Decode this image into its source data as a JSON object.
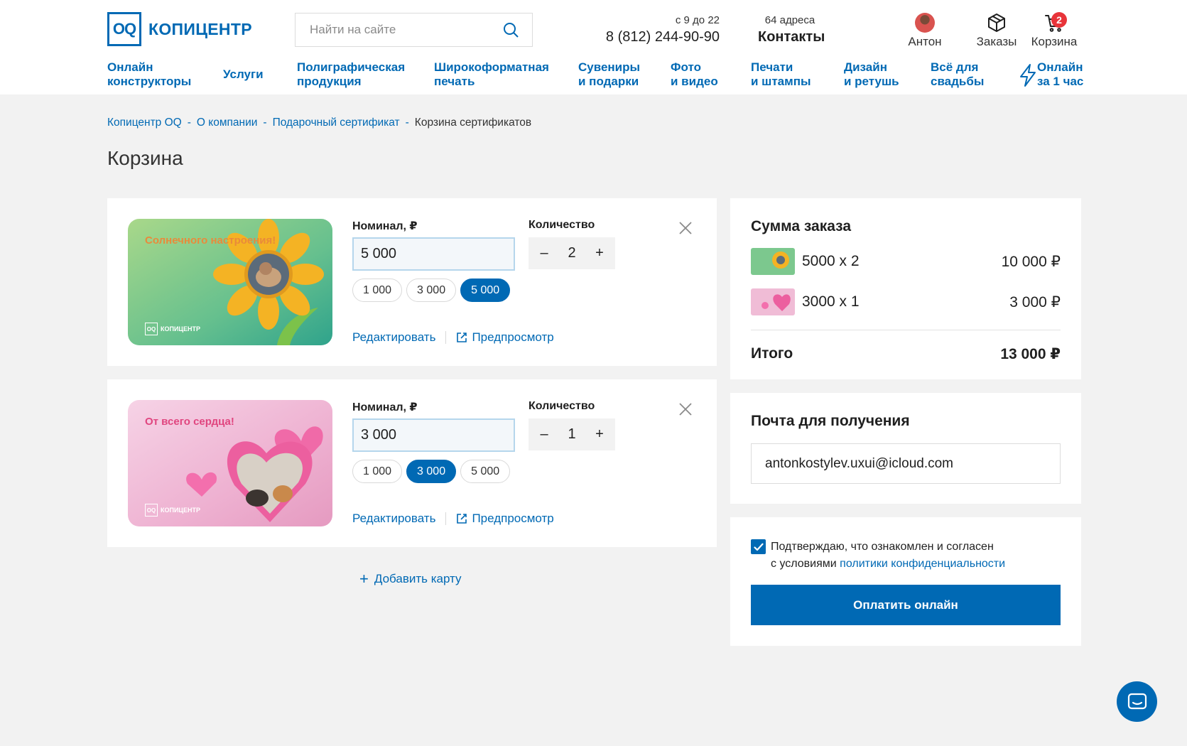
{
  "header": {
    "logo_mark": "OQ",
    "logo_text": "КОПИЦЕНТР",
    "search_placeholder": "Найти на сайте",
    "hours": "с 9 до 22",
    "phone": "8 (812) 244-90-90",
    "addresses": "64 адреса",
    "contacts": "Контакты",
    "user_name": "Антон",
    "orders": "Заказы",
    "cart": "Корзина",
    "cart_count": "2"
  },
  "nav": [
    {
      "l1": "Онлайн",
      "l2": "конструкторы"
    },
    {
      "l1": "Услуги",
      "l2": ""
    },
    {
      "l1": "Полиграфическая",
      "l2": "продукция"
    },
    {
      "l1": "Широкоформатная",
      "l2": "печать"
    },
    {
      "l1": "Сувениры",
      "l2": "и подарки"
    },
    {
      "l1": "Фото",
      "l2": "и видео"
    },
    {
      "l1": "Печати",
      "l2": "и штампы"
    },
    {
      "l1": "Дизайн",
      "l2": "и ретушь"
    },
    {
      "l1": "Всё для",
      "l2": "свадьбы"
    },
    {
      "l1": "Онлайн",
      "l2": "за 1 час"
    }
  ],
  "breadcrumb": {
    "items": [
      "Копицентр OQ",
      "О компании",
      "Подарочный сертификат"
    ],
    "current": "Корзина сертификатов",
    "separator": "-"
  },
  "page_title": "Корзина",
  "cart_items": [
    {
      "card_text": "Солнечного настроения!",
      "card_brand": "КОПИЦЕНТР",
      "nominal_label": "Номинал, ₽",
      "nominal_value": "5 000",
      "chips": [
        "1 000",
        "3 000",
        "5 000"
      ],
      "active_chip": 2,
      "quantity_label": "Количество",
      "quantity": "2",
      "minus": "–",
      "plus": "+",
      "edit": "Редактировать",
      "preview": "Предпросмотр"
    },
    {
      "card_text": "От всего сердца!",
      "card_brand": "КОПИЦЕНТР",
      "nominal_label": "Номинал, ₽",
      "nominal_value": "3 000",
      "chips": [
        "1 000",
        "3 000",
        "5 000"
      ],
      "active_chip": 1,
      "quantity_label": "Количество",
      "quantity": "1",
      "minus": "–",
      "plus": "+",
      "edit": "Редактировать",
      "preview": "Предпросмотр"
    }
  ],
  "add_card": "Добавить карту",
  "summary": {
    "title": "Сумма заказа",
    "rows": [
      {
        "name": "5000 x 2",
        "price": "10 000 ₽"
      },
      {
        "name": "3000 x 1",
        "price": "3 000 ₽"
      }
    ],
    "total_label": "Итого",
    "total_value": "13 000 ₽"
  },
  "email": {
    "title": "Почта для получения",
    "value": "antonkostylev.uxui@icloud.com"
  },
  "consent": {
    "line1": "Подтверждаю, что ознакомлен и согласен",
    "line2_prefix": "с условиями",
    "link": "политики конфиденциальности",
    "checked": true
  },
  "pay_button": "Оплатить онлайн",
  "colors": {
    "brand": "#0069b4",
    "badge": "#e8343a",
    "background": "#f2f2f2"
  }
}
